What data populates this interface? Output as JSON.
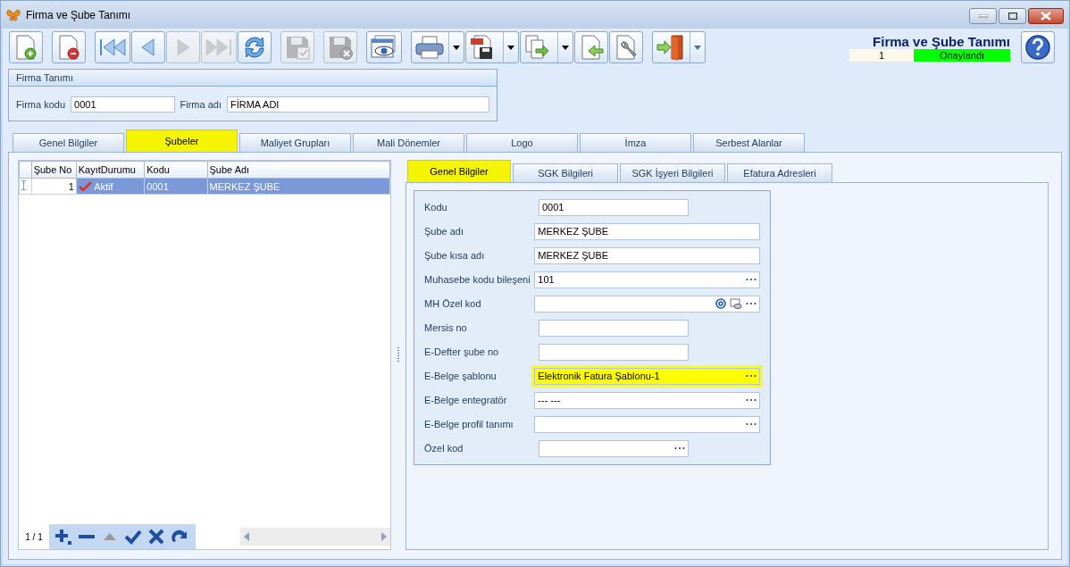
{
  "window": {
    "title": "Firma ve Şube Tanımı"
  },
  "toolbar": [
    [
      {
        "kind": "new",
        "disabled": false,
        "dropdown": false
      }
    ],
    [
      {
        "kind": "delete",
        "disabled": false,
        "dropdown": false
      }
    ],
    [
      {
        "kind": "first",
        "disabled": false,
        "dropdown": false
      },
      {
        "kind": "prev",
        "disabled": false,
        "dropdown": false
      },
      {
        "kind": "next",
        "disabled": true,
        "dropdown": false
      },
      {
        "kind": "last",
        "disabled": true,
        "dropdown": false
      },
      {
        "kind": "refresh",
        "disabled": false,
        "dropdown": false
      }
    ],
    [
      {
        "kind": "save",
        "disabled": true,
        "dropdown": false
      }
    ],
    [
      {
        "kind": "cancel",
        "disabled": true,
        "dropdown": false
      }
    ],
    [
      {
        "kind": "preview",
        "disabled": false,
        "dropdown": false
      }
    ],
    [
      {
        "kind": "print",
        "disabled": false,
        "dropdown": true
      },
      {
        "kind": "pdf",
        "disabled": false,
        "dropdown": true
      },
      {
        "kind": "export",
        "disabled": false,
        "dropdown": true
      },
      {
        "kind": "import",
        "disabled": false,
        "dropdown": false
      },
      {
        "kind": "tools",
        "disabled": false,
        "dropdown": false
      }
    ],
    [
      {
        "kind": "exit",
        "disabled": false,
        "dropdown": true
      }
    ]
  ],
  "header": {
    "title": "Firma ve Şube Tanımı",
    "record": "1",
    "status": "Onaylandı"
  },
  "firma_group": {
    "title": "Firma Tanımı",
    "fields": [
      {
        "label": "Firma kodu",
        "value": "0001"
      },
      {
        "label": "Firma adı",
        "value": "FİRMA ADI"
      }
    ]
  },
  "main_tabs": [
    {
      "label": "Genel Bilgiler",
      "selected": false
    },
    {
      "label": "Şubeler",
      "selected": true
    },
    {
      "label": "Maliyet Grupları",
      "selected": false
    },
    {
      "label": "Mali Dönemler",
      "selected": false
    },
    {
      "label": "Logo",
      "selected": false
    },
    {
      "label": "İmza",
      "selected": false
    },
    {
      "label": "Serbest Alanlar",
      "selected": false
    }
  ],
  "grid": {
    "columns": [
      "Şube No",
      "KayıtDurumu",
      "Kodu",
      "Şube Adı"
    ],
    "rows": [
      {
        "cells": [
          "1",
          "Aktif",
          "0001",
          "MERKEZ ŞUBE"
        ],
        "selected": true
      }
    ],
    "navigator": {
      "page": "1 / 1",
      "buttons": [
        {
          "kind": "add",
          "disabled": false
        },
        {
          "kind": "remove",
          "disabled": false
        },
        {
          "kind": "up",
          "disabled": true
        },
        {
          "kind": "check",
          "disabled": false
        },
        {
          "kind": "cancel",
          "disabled": false
        },
        {
          "kind": "redo",
          "disabled": false
        }
      ]
    }
  },
  "sub_tabs": [
    {
      "label": "Genel Bilgiler",
      "selected": true
    },
    {
      "label": "SGK Bilgileri",
      "selected": false
    },
    {
      "label": "SGK İşyeri Bilgileri",
      "selected": false
    },
    {
      "label": "Efatura Adresleri",
      "selected": false
    }
  ],
  "form": [
    {
      "label": "Kodu",
      "value": "0001",
      "wide": false,
      "lookup": false,
      "extras": false,
      "highlighted": false
    },
    {
      "label": "Şube adı",
      "value": "MERKEZ ŞUBE",
      "wide": true,
      "lookup": false,
      "extras": false,
      "highlighted": false
    },
    {
      "label": "Şube kısa adı",
      "value": "MERKEZ ŞUBE",
      "wide": true,
      "lookup": false,
      "extras": false,
      "highlighted": false
    },
    {
      "label": "Muhasebe kodu bileşeni",
      "value": "101",
      "wide": true,
      "lookup": true,
      "extras": false,
      "highlighted": false
    },
    {
      "label": "MH Özel kod",
      "wide": true,
      "lookup": true,
      "extras": true,
      "highlighted": false
    },
    {
      "label": "Mersis no",
      "wide": false,
      "lookup": false,
      "extras": false,
      "highlighted": false
    },
    {
      "label": "E-Defter şube no",
      "wide": false,
      "lookup": false,
      "extras": false,
      "highlighted": false
    },
    {
      "label": "E-Belge şablonu",
      "value": "Elektronik Fatura Şablonu-1",
      "wide": true,
      "lookup": true,
      "extras": false,
      "highlighted": true
    },
    {
      "label": "E-Belge entegratör",
      "value": "--- ---",
      "wide": true,
      "lookup": true,
      "extras": false,
      "highlighted": false
    },
    {
      "label": "E-Belge profil tanımı",
      "wide": true,
      "lookup": true,
      "extras": false,
      "highlighted": false
    },
    {
      "label": "Özel kod",
      "wide": false,
      "lookup": true,
      "extras": false,
      "highlighted": false
    }
  ]
}
